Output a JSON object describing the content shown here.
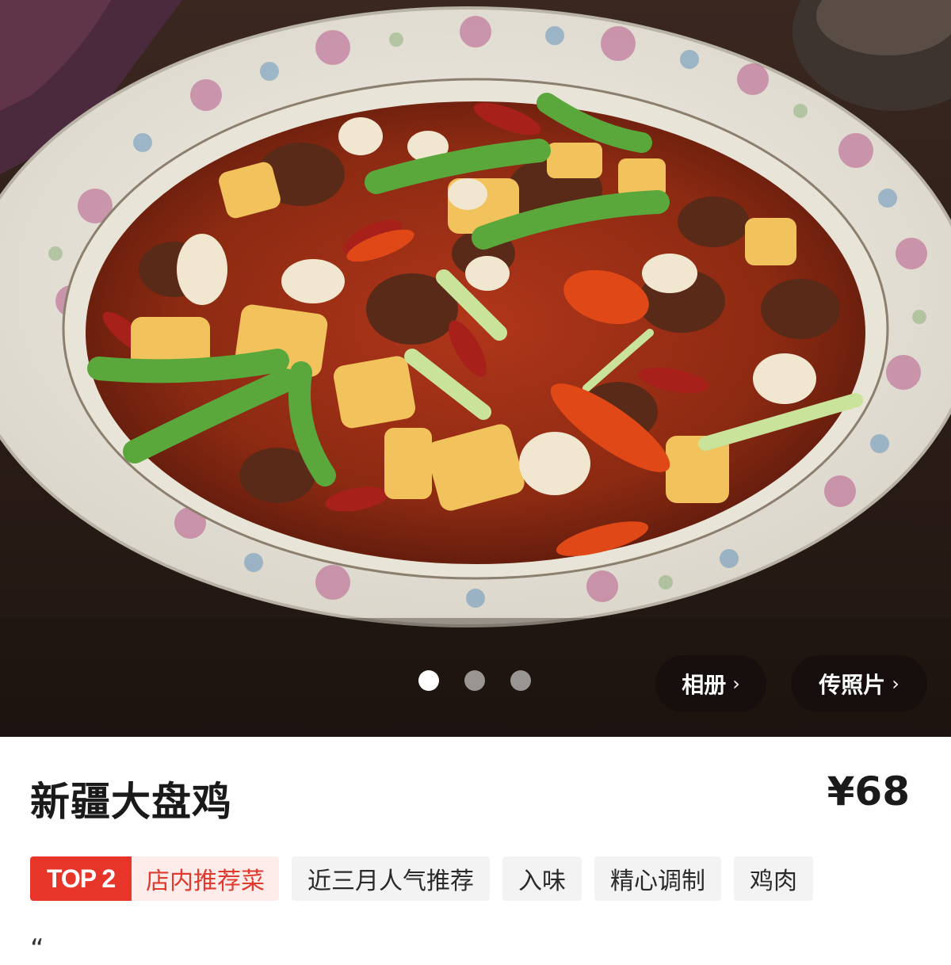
{
  "gallery": {
    "photo": "large-plate-chicken-photo",
    "page_count": 3,
    "active_index": 0,
    "album_label": "相册",
    "upload_label": "传照片",
    "chevron_icon": "chevron-right-icon"
  },
  "dish": {
    "name": "新疆大盘鸡",
    "price": "¥68"
  },
  "rank_tag": {
    "rank": "TOP 2",
    "label": "店内推荐菜",
    "color": "#e8352a"
  },
  "tags": [
    "近三月人气推荐",
    "入味",
    "精心调制",
    "鸡肉"
  ],
  "review_snippet": "“",
  "colors": {
    "accent": "#e8352a",
    "text": "#1a1a1a",
    "tag_bg": "#f3f3f3"
  }
}
